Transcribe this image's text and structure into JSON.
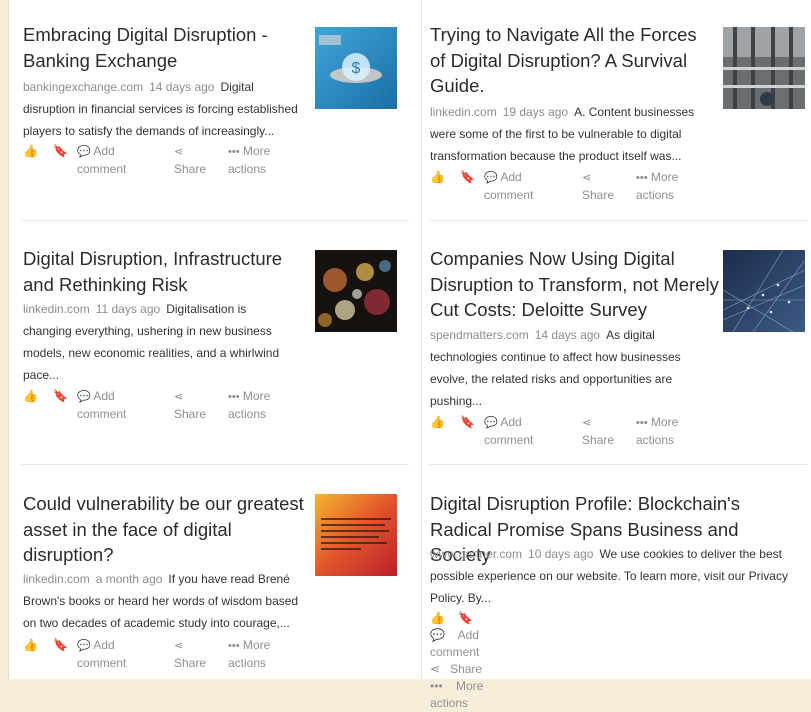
{
  "actions": {
    "add_comment_line1": "Add",
    "add_comment_line2": "comment",
    "share": "Share",
    "more_line1": "More",
    "more_line2": "actions",
    "add_comment_inline": "Add comment",
    "more_inline": "More actions"
  },
  "articles": [
    {
      "title": "Embracing Digital Disruption - Banking Exchange",
      "source": "bankingexchange.com",
      "age": "14 days ago",
      "snippet": "Digital disruption in financial services is forcing established players to satisfy the demands of increasingly..."
    },
    {
      "title": "Trying to Navigate All the Forces of Digital Disruption? A Survival Guide.",
      "source": "linkedin.com",
      "age": "19 days ago",
      "snippet": "A. Content businesses were some of the first to be vulnerable to digital transformation because the product itself was..."
    },
    {
      "title": "Digital Disruption, Infrastructure and Rethinking Risk",
      "source": "linkedin.com",
      "age": "11 days ago",
      "snippet": "Digitalisation is changing everything, ushering in new business models, new economic realities, and a whirlwind pace..."
    },
    {
      "title": "Companies Now Using Digital Disruption to Transform, not Merely Cut Costs: Deloitte Survey",
      "source": "spendmatters.com",
      "age": "14 days ago",
      "snippet": "As digital technologies continue to affect how businesses evolve, the related risks and opportunities are pushing..."
    },
    {
      "title": "Could vulnerability be our greatest asset in the face of digital disruption?",
      "source": "linkedin.com",
      "age": "a month ago",
      "snippet": "If you have read Brené Brown's books or heard her words of wisdom based on two decades of academic study into courage,..."
    },
    {
      "title": "Digital Disruption Profile: Blockchain's Radical Promise Spans Business and Society",
      "source": "www.gartner.com",
      "age": "10 days ago",
      "snippet": "We use cookies to deliver the best possible experience on our website. To learn more, visit our Privacy Policy. By..."
    }
  ],
  "icons": {
    "like": "thumbs-up-icon",
    "bookmark": "bookmark-icon",
    "comment": "comment-icon",
    "share": "share-icon",
    "more": "ellipsis-icon"
  },
  "colors": {
    "background": "#f6eedb",
    "title": "#2b2b2b",
    "meta": "#8c8c8c",
    "action": "#8f8f8f"
  }
}
